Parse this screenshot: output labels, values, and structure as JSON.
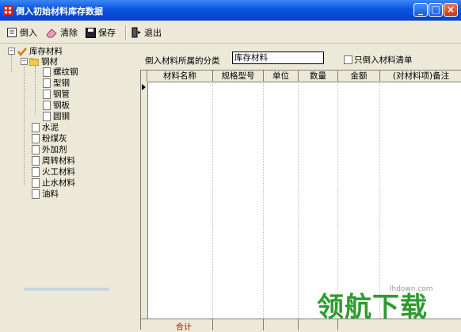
{
  "window": {
    "title": "倒入初始材料库存数据"
  },
  "toolbar": {
    "import_label": "倒入",
    "clear_label": "清除",
    "save_label": "保存",
    "exit_label": "退出"
  },
  "tree": {
    "root": "库存材料",
    "group": "钢材",
    "steel_items": [
      "螺纹钢",
      "型钢",
      "钢管",
      "钢板",
      "圆钢"
    ],
    "items": [
      "水泥",
      "粉煤灰",
      "外加剂",
      "周转材料",
      "火工材料",
      "止水材料",
      "油料"
    ]
  },
  "form": {
    "category_label": "倒入材料所属的分类",
    "category_value": "库存材料",
    "only_list_label": "只倒入材料清单"
  },
  "grid": {
    "columns": [
      "材料名称",
      "规格型号",
      "单位",
      "数量",
      "金额",
      "(对材料项)备注"
    ],
    "total_label": "合计"
  },
  "watermark": {
    "site": "lhdown.com",
    "brand": "领航下载"
  },
  "colors": {
    "titlebar": "#0a55e0",
    "total_text": "#c00000",
    "watermark": "#2e9b2e"
  }
}
